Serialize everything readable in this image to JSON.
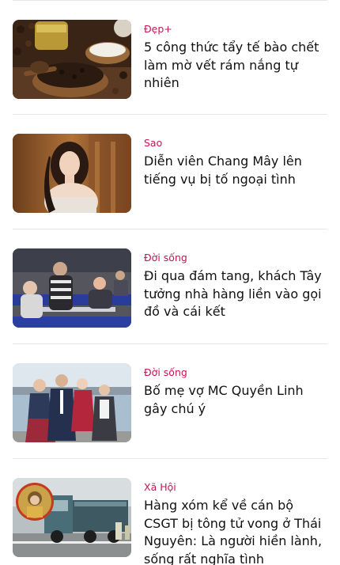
{
  "articles": [
    {
      "category": "Đẹp+",
      "title": "5 công thức tẩy tế bào chết làm mờ vết rám nắng tự nhiên",
      "image": "coffee-scrub-bowls-photo"
    },
    {
      "category": "Sao",
      "title": "Diễn viên Chang Mây lên tiếng vụ bị tố ngoại tình",
      "image": "actress-portrait-photo"
    },
    {
      "category": "Đời sống",
      "title": "Đi qua đám tang, khách Tây tưởng nhà hàng liền vào gọi đồ và cái kết",
      "image": "funeral-tables-photo"
    },
    {
      "category": "Đời sống",
      "title": "Bố mẹ vợ MC Quyền Linh gây chú ý",
      "image": "family-group-photo"
    },
    {
      "category": "Xã Hội",
      "title": "Hàng xóm kể về cán bộ CSGT bị tông tử vong ở Thái Nguyên: Là người hiền lành, sống rất nghĩa tình",
      "image": "truck-accident-scene-photo"
    }
  ],
  "colors": {
    "category": "#c8134e",
    "title": "#111111",
    "divider": "#e7e7e7"
  }
}
